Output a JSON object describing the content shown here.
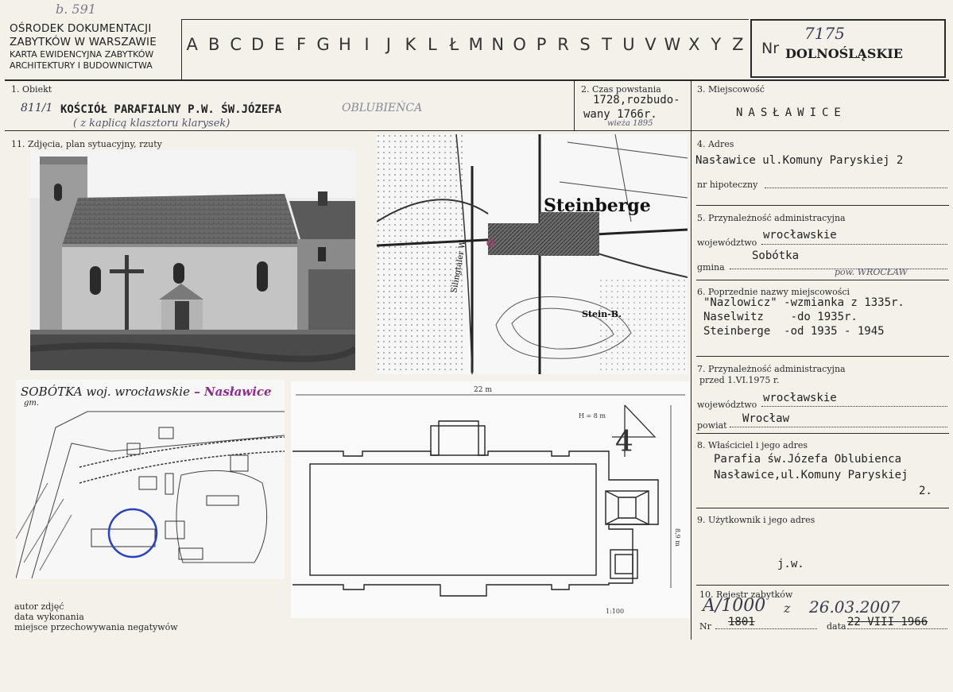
{
  "header": {
    "org": [
      "OŚRODEK DOKUMENTACJI",
      "ZABYTKÓW W WARSZAWIE",
      "KARTA EWIDENCYJNA ZABYTKÓW",
      "ARCHITEKTURY I BUDOWNICTWA"
    ],
    "top_note": "b. 591",
    "letters": [
      "A",
      "B",
      "C",
      "D",
      "E",
      "F",
      "G",
      "H",
      "I",
      "J",
      "K",
      "L",
      "Ł",
      "M",
      "N",
      "O",
      "P",
      "R",
      "S",
      "T",
      "U",
      "V",
      "W",
      "X",
      "Y",
      "Z"
    ],
    "nr_label": "Nr",
    "nr_handwritten": "7175",
    "voivodeship": "DOLNOŚLĄSKIE"
  },
  "obiekt": {
    "label": "1. Obiekt",
    "hand_prefix": "811/1",
    "value": "KOŚCIÓŁ PARAFIALNY P.W. ŚW.JÓZEFA",
    "hand_suffix": "OBLUBIEŃCA",
    "hand_note": "( z kaplicą klasztoru klarysek)"
  },
  "czas": {
    "label": "2. Czas powstania",
    "value_line1": "1728,rozbudo-",
    "value_line2": "wany 1766r.",
    "hand_note": "wieża 1895"
  },
  "miejscowosc": {
    "label": "3. Miejscowość",
    "value": "NASŁAWICE"
  },
  "zdjecia": {
    "label": "11. Zdjęcia, plan sytuacyjny, rzuty"
  },
  "adres": {
    "label": "4. Adres",
    "value": "Nasławice ul.Komuny Paryskiej 2",
    "hipoteczny_label": "nr hipoteczny"
  },
  "przynaleznosc": {
    "label": "5. Przynależność administracyjna",
    "woj_label": "województwo",
    "woj_value": "wrocławskie",
    "gmina_label": "gmina",
    "gmina_value": "Sobótka",
    "hand_note": "pow. WROCŁAW"
  },
  "poprzednie": {
    "label": "6. Poprzednie nazwy miejscowości",
    "rows": [
      "\"Nazlowicz\" -wzmianka z 1335r.",
      "Naselwitz    -do 1935r.",
      "Steinberge  -od 1935 - 1945"
    ]
  },
  "przynaleznosc_1975": {
    "label_line1": "7. Przynależność administracyjna",
    "label_line2": "przed 1.VI.1975 r.",
    "woj_label": "województwo",
    "woj_value": "wrocławskie",
    "powiat_label": "powiat",
    "powiat_value": "Wrocław"
  },
  "wlasciciel": {
    "label": "8. Właściciel i jego adres",
    "line1": "Parafia św.Józefa Oblubienca",
    "line2": "Nasławice,ul.Komuny Paryskiej",
    "line3": "2."
  },
  "uzytkownik": {
    "label": "9. Użytkownik i jego adres",
    "value": "j.w."
  },
  "rejestr": {
    "label": "10. Rejestr zabytków",
    "hand_nr": "A/1000",
    "hand_z": "z",
    "hand_date": "26.03.2007",
    "nr_label": "Nr",
    "nr_value": "1801",
    "data_label": "data",
    "data_value": "22 VIII 1966"
  },
  "map": {
    "town_label": "Steinberge",
    "hill_label": "Stein-B.",
    "road_label": "Silingtaler W."
  },
  "site_plan": {
    "title_black": "SOBÓTKA  woj. wrocławskie",
    "title_purple": " – Nasławice",
    "gm": "gm."
  },
  "floor_plan": {
    "width_label": "22 m",
    "height_label": "8,9 m",
    "scale": "1:100",
    "h_label": "H = 8 m",
    "sheet_no": "4"
  },
  "footer": {
    "lines": [
      "autor zdjęć",
      "data wykonania",
      "miejsce przechowywania negatywów"
    ]
  }
}
